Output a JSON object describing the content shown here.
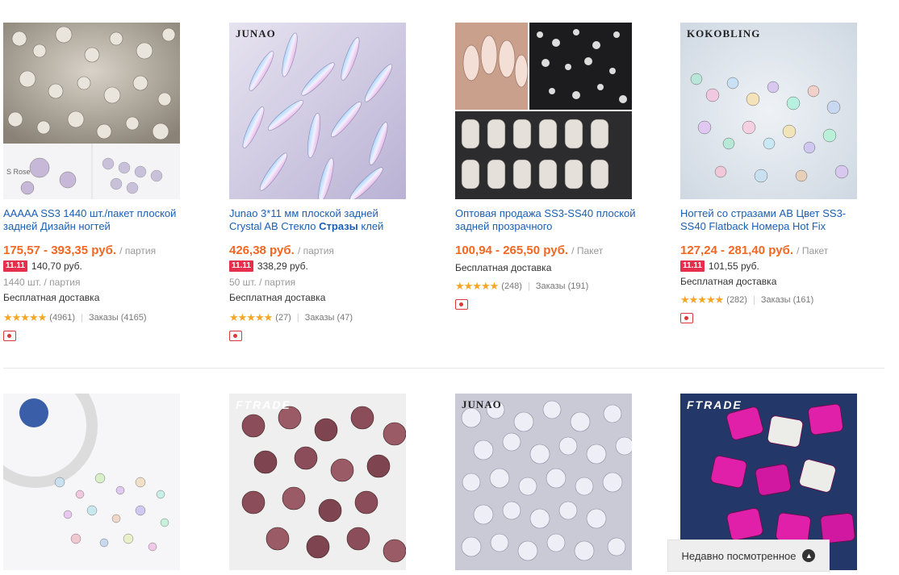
{
  "row1": [
    {
      "brand": "",
      "title_pre": "AAAAA SS3 1440 шт./пакет плоской задней Дизайн ногтей",
      "title_bold": "",
      "title_post": "",
      "price": "175,57 - 393,35 руб.",
      "unit": "/ партия",
      "promo_badge": "11.11",
      "promo_price": "140,70 руб.",
      "lot": "1440 шт. / партия",
      "shipping": "Бесплатная доставка",
      "stars": "★★★★★",
      "reviews": "(4961)",
      "orders": "Заказы (4165)"
    },
    {
      "brand": "JUNAO",
      "title_pre": "Junao 3*11 мм плоской задней Crystal AB Стекло ",
      "title_bold": "Стразы",
      "title_post": " клей",
      "price": "426,38 руб.",
      "unit": "/ партия",
      "promo_badge": "11.11",
      "promo_price": "338,29 руб.",
      "lot": "50 шт. / партия",
      "shipping": "Бесплатная доставка",
      "stars": "★★★★★",
      "reviews": "(27)",
      "orders": "Заказы (47)"
    },
    {
      "brand": "",
      "title_pre": "Оптовая продажа SS3-SS40 плоской задней прозрачного",
      "title_bold": "",
      "title_post": "",
      "price": "100,94 - 265,50 руб.",
      "unit": "/ Пакет",
      "shipping": "Бесплатная доставка",
      "stars": "★★★★★",
      "reviews": "(248)",
      "orders": "Заказы (191)"
    },
    {
      "brand": "KOKOBLING",
      "title_pre": "Ногтей со стразами AB Цвет SS3-SS40 Flatback Номера Hot Fix",
      "title_bold": "",
      "title_post": "",
      "price": "127,24 - 281,40 руб.",
      "unit": "/ Пакет",
      "promo_badge": "11.11",
      "promo_price": "101,55 руб.",
      "shipping": "Бесплатная доставка",
      "stars": "★★★★★",
      "reviews": "(282)",
      "orders": "Заказы (161)"
    }
  ],
  "row2_brands": [
    "",
    "FTRADE",
    "JUNAO",
    "FTRADE"
  ],
  "recently_viewed": "Недавно посмотренное",
  "colors": {
    "price": "#f26722",
    "link": "#1a5fb4",
    "badge": "#e62e4d",
    "stars": "#f5a623"
  }
}
